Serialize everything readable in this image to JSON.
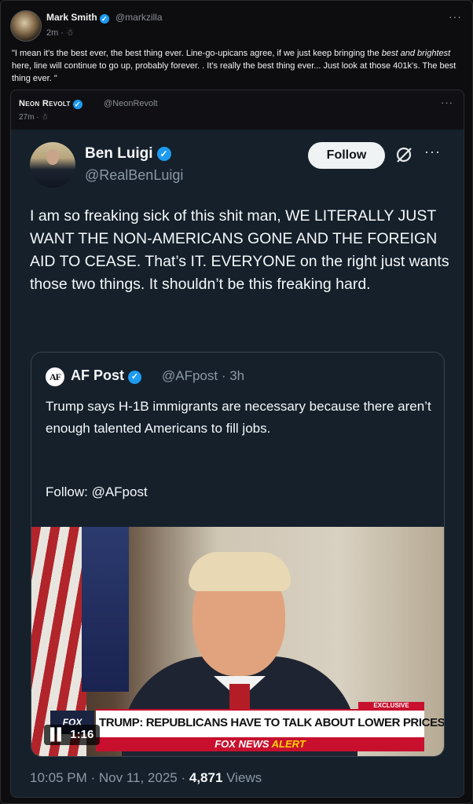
{
  "post": {
    "author_name": "Mark Smith",
    "author_handle": "@markzilla",
    "time": "2m · ☃",
    "text_html_parts": {
      "p1": "\"I mean it's the best ever, the best thing ever. Line-go-upicans agree, if we just keep bringing the ",
      "em1": "best and brightest",
      "p2": " here, line will continue to go up, probably forever. . It's really the best thing ever... Just look at those 401k's. The best thing ever. \""
    },
    "more": "···"
  },
  "quoted": {
    "author_name": "Neon Revolt",
    "author_handle": "@NeonRevolt",
    "time": "27m · ☃",
    "more": "···"
  },
  "screenshot": {
    "author_name": "Ben Luigi",
    "author_handle": "@RealBenLuigi",
    "follow_label": "Follow",
    "more": "···",
    "text": "I am so freaking sick of this shit man, WE LITERALLY JUST WANT THE NON-AMERICANS GONE AND THE FOREIGN AID TO CEASE. That’s IT. EVERYONE on the right just wants those two things. It shouldn’t be this freaking hard.",
    "inner": {
      "logo_text": "AF",
      "author_name": "AF Post",
      "author_handle": "@AFpost · 3h",
      "text": "Trump says H-1B immigrants are necessary because there aren’t enough talented Americans to fill jobs.",
      "follow_line": "Follow: @AFpost",
      "video": {
        "exclusive": "EXCLUSIVE",
        "headline": "TRUMP: REPUBLICANS HAVE TO TALK ABOUT LOWER PRICES",
        "alert_white": "FOX NEWS ",
        "alert_yellow": "ALERT",
        "logo": "FOX",
        "duration": "1:16"
      }
    },
    "timestamp": "10:05 PM · Nov 11, 2025 · ",
    "views_count": "4,871",
    "views_label": " Views"
  },
  "colors": {
    "verified": "#1d9bf0",
    "background": "#0d0d10",
    "tweet_bg": "#15202b",
    "fox_red": "#c8102e"
  }
}
